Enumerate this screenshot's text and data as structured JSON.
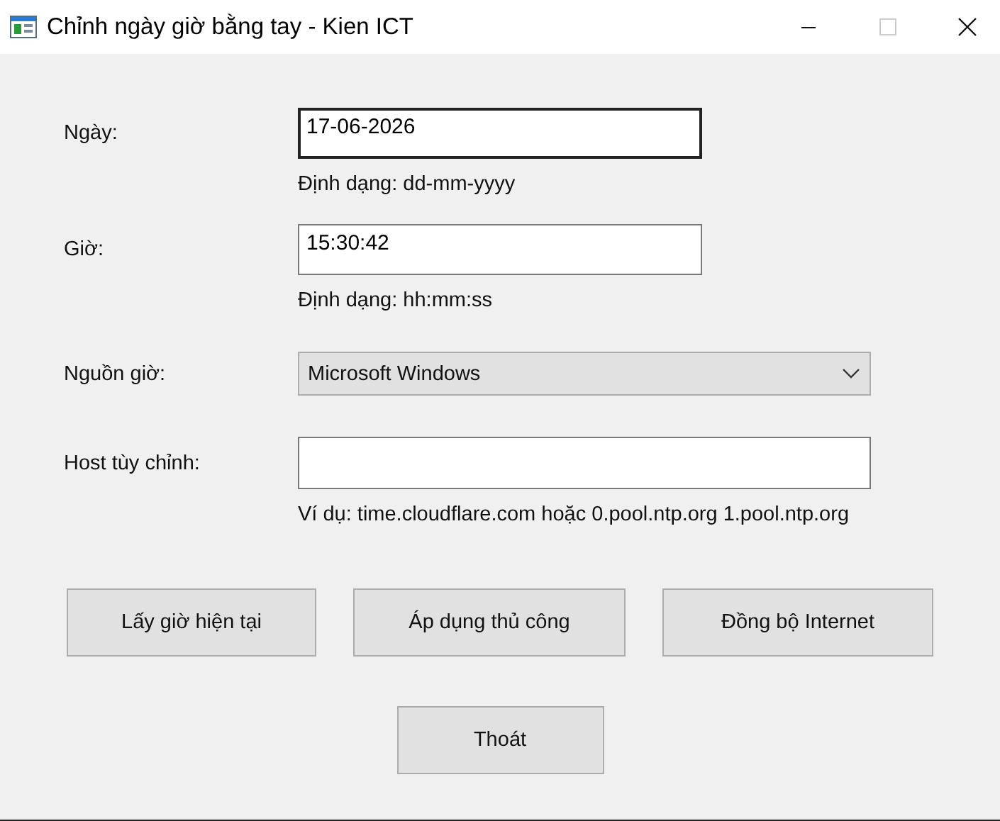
{
  "window": {
    "title": "Chỉnh ngày giờ bằng tay - Kien ICT",
    "controls": [
      {
        "kind": "minimize",
        "disabled": false
      },
      {
        "kind": "maximize",
        "disabled": true
      },
      {
        "kind": "close",
        "disabled": false
      }
    ]
  },
  "fields": [
    {
      "kind": "text",
      "label": "Ngày:",
      "value": "17-06-2026",
      "focused": true,
      "hint": "Định dạng: dd-mm-yyyy"
    },
    {
      "kind": "text",
      "label": "Giờ:",
      "value": "15:30:42",
      "focused": false,
      "hint": "Định dạng: hh:mm:ss"
    },
    {
      "kind": "dropdown",
      "label": "Nguồn giờ:",
      "value": "Microsoft Windows"
    },
    {
      "kind": "text",
      "label": "Host tùy chỉnh:",
      "focused": false,
      "hint": "Ví dụ: time.cloudflare.com hoặc 0.pool.ntp.org 1.pool.ntp.org"
    }
  ],
  "buttons": [
    "Lấy giờ hiện tại",
    "Áp dụng thủ công",
    "Đồng bộ Internet"
  ],
  "exit_button": "Thoát"
}
